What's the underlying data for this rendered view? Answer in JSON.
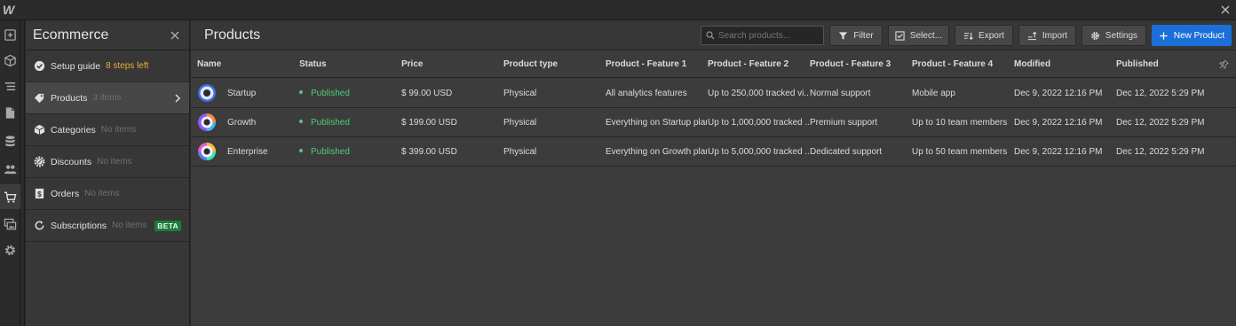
{
  "app": {
    "logo": "W"
  },
  "sidebar": {
    "title": "Ecommerce",
    "items": [
      {
        "label": "Setup guide",
        "sub": "8 steps left",
        "icon": "check-circle-icon"
      },
      {
        "label": "Products",
        "sub": "3 items",
        "icon": "tag-icon"
      },
      {
        "label": "Categories",
        "sub": "No items",
        "icon": "box-icon"
      },
      {
        "label": "Discounts",
        "sub": "No items",
        "icon": "discount-gear-icon"
      },
      {
        "label": "Orders",
        "sub": "No items",
        "icon": "dollar-doc-icon"
      },
      {
        "label": "Subscriptions",
        "sub": "No items",
        "icon": "refresh-icon",
        "badge": "BETA"
      }
    ]
  },
  "main": {
    "title": "Products",
    "search": {
      "placeholder": "Search products..."
    },
    "toolbar": {
      "filter": "Filter",
      "select": "Select...",
      "export": "Export",
      "import": "Import",
      "settings": "Settings",
      "new_product": "New Product"
    },
    "columns": [
      "Name",
      "Status",
      "Price",
      "Product type",
      "Product - Feature 1",
      "Product - Feature 2",
      "Product - Feature 3",
      "Product - Feature 4",
      "Modified",
      "Published"
    ],
    "rows": [
      {
        "name": "Startup",
        "status": "Published",
        "price": "$ 99.00 USD",
        "type": "Physical",
        "f1": "All analytics features",
        "f2": "Up to 250,000 tracked vi...",
        "f3": "Normal support",
        "f4": "Mobile app",
        "modified": "Dec 9, 2022 12:16 PM",
        "published": "Dec 12, 2022 5:29 PM"
      },
      {
        "name": "Growth",
        "status": "Published",
        "price": "$ 199.00 USD",
        "type": "Physical",
        "f1": "Everything on Startup plan",
        "f2": "Up to 1,000,000 tracked ...",
        "f3": "Premium support",
        "f4": "Up to 10 team members",
        "modified": "Dec 9, 2022 12:16 PM",
        "published": "Dec 12, 2022 5:29 PM"
      },
      {
        "name": "Enterprise",
        "status": "Published",
        "price": "$ 399.00 USD",
        "type": "Physical",
        "f1": "Everything on Growth plan",
        "f2": "Up to 5,000,000 tracked ...",
        "f3": "Dedicated support",
        "f4": "Up to 50 team members",
        "modified": "Dec 9, 2022 12:16 PM",
        "published": "Dec 12, 2022 5:29 PM"
      }
    ]
  },
  "colors": {
    "accent": "#1a6fd8",
    "published": "#4ccd78",
    "steps_left": "#f2a93b",
    "beta": "#1f7a3a"
  }
}
